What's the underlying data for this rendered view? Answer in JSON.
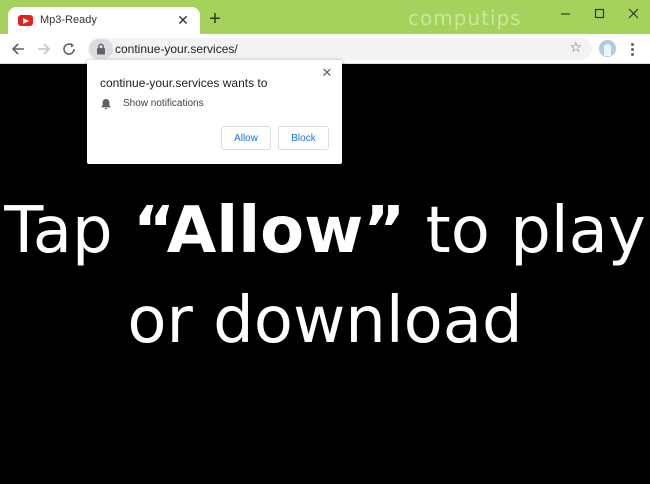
{
  "tab": {
    "title": "Mp3-Ready",
    "close_glyph": "✕",
    "favicon": "youtube-icon"
  },
  "new_tab_glyph": "+",
  "watermark": "computips",
  "window_controls": {
    "minimize": "—",
    "maximize": "☐",
    "close": "✕"
  },
  "address_bar": {
    "url": "continue-your.services/",
    "bookmark_glyph": "☆"
  },
  "popup": {
    "title": "continue-your.services wants to",
    "permission": "Show notifications",
    "allow_label": "Allow",
    "block_label": "Block",
    "close_glyph": "✕"
  },
  "page": {
    "line1_pre": "Tap ",
    "line1_bold": "“Allow”",
    "line1_post": " to play",
    "line2": "or download"
  },
  "colors": {
    "titlebar": "#a5d15d",
    "accent": "#1a73e8",
    "page_background": "#000000"
  }
}
